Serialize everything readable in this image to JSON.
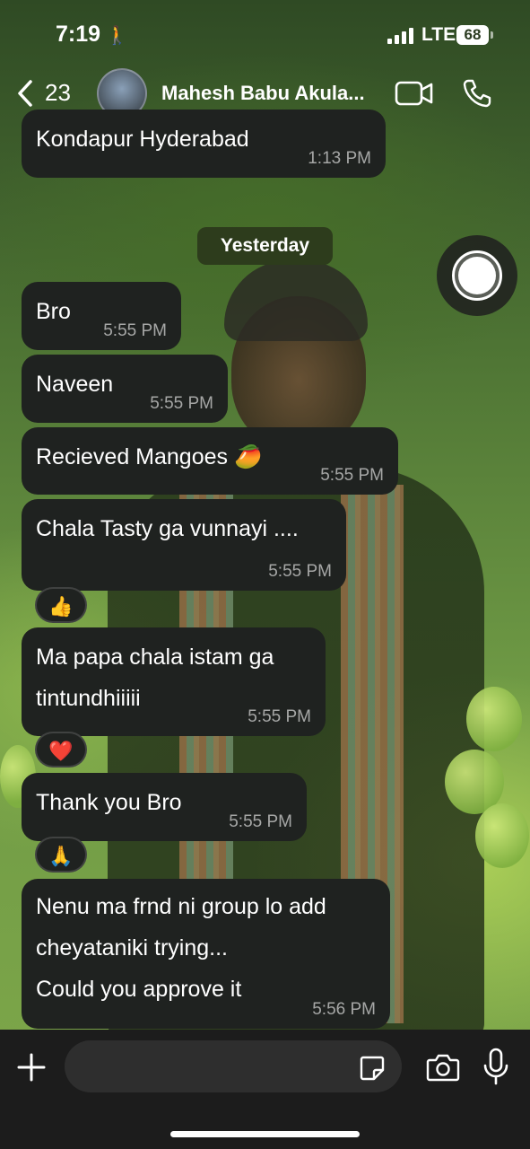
{
  "status_bar": {
    "time": "7:19",
    "network": "LTE",
    "battery": "68"
  },
  "header": {
    "unread_count": "23",
    "contact_name": "Mahesh Babu Akula..."
  },
  "chat": {
    "date_separator": "Yesterday",
    "messages": [
      {
        "lines": [
          "Kondapur Hyderabad"
        ],
        "time": "1:13 PM"
      },
      {
        "lines": [
          "Bro"
        ],
        "time": "5:55 PM"
      },
      {
        "lines": [
          "Naveen"
        ],
        "time": "5:55 PM"
      },
      {
        "lines": [
          "Recieved Mangoes 🥭"
        ],
        "time": "5:55 PM"
      },
      {
        "lines": [
          "Chala Tasty ga vunnayi ...."
        ],
        "time": "5:55 PM",
        "reaction": "👍"
      },
      {
        "lines": [
          "Ma papa chala istam ga",
          "tintundhiiiii"
        ],
        "time": "5:55 PM",
        "reaction": "❤️"
      },
      {
        "lines": [
          "Thank you Bro"
        ],
        "time": "5:55 PM",
        "reaction": "🙏"
      },
      {
        "lines": [
          "Nenu ma frnd ni group lo add",
          "cheyataniki trying...",
          "Could you approve it"
        ],
        "time": "5:56 PM"
      }
    ]
  },
  "input": {
    "placeholder": ""
  },
  "icons": [
    "back-icon",
    "video-call-icon",
    "phone-call-icon",
    "plus-icon",
    "sticker-icon",
    "camera-icon",
    "mic-icon",
    "record-button"
  ],
  "colors": {
    "bubble": "#1f2220",
    "date_chip": "#2d3c1c",
    "input_bar": "#1c1c1c"
  }
}
